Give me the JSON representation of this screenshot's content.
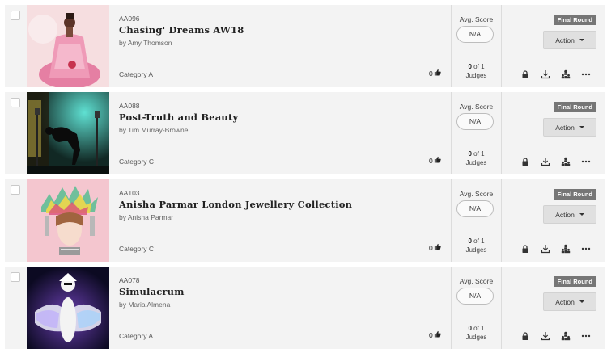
{
  "submissions": [
    {
      "code": "AA096",
      "title": "Chasing' Dreams AW18",
      "author": "by Amy Thomson",
      "category": "Category A",
      "votes": "0",
      "score_label": "Avg. Score",
      "score_value": "N/A",
      "judges_count": "0",
      "judges_of": "of 1",
      "judges_label": "Judges",
      "badge": "Final Round",
      "action_label": "Action",
      "thumbnail": "fashion-pink-dress-photo"
    },
    {
      "code": "AA088",
      "title": "Post-Truth and Beauty",
      "author": "by Tim Murray-Browne",
      "category": "Category C",
      "votes": "0",
      "score_label": "Avg. Score",
      "score_value": "N/A",
      "judges_count": "0",
      "judges_of": "of 1",
      "judges_label": "Judges",
      "badge": "Final Round",
      "action_label": "Action",
      "thumbnail": "performance-silhouette-photo"
    },
    {
      "code": "AA103",
      "title": "Anisha Parmar London Jewellery Collection",
      "author": "by Anisha Parmar",
      "category": "Category C",
      "votes": "0",
      "score_label": "Avg. Score",
      "score_value": "N/A",
      "judges_count": "0",
      "judges_of": "of 1",
      "judges_label": "Judges",
      "badge": "Final Round",
      "action_label": "Action",
      "thumbnail": "jewellery-headpiece-photo"
    },
    {
      "code": "AA078",
      "title": "Simulacrum",
      "author": "by Maria Almena",
      "category": "Category A",
      "votes": "0",
      "score_label": "Avg. Score",
      "score_value": "N/A",
      "judges_count": "0",
      "judges_of": "of 1",
      "judges_label": "Judges",
      "badge": "Final Round",
      "action_label": "Action",
      "thumbnail": "white-feather-costume-photo"
    }
  ],
  "icons": [
    "thumbs-up-icon",
    "lock-icon",
    "download-icon",
    "hierarchy-icon",
    "more-icon"
  ],
  "colors": {
    "row_bg": "#f3f3f3",
    "badge_bg": "#767676",
    "action_bg": "#e0e0e0"
  }
}
